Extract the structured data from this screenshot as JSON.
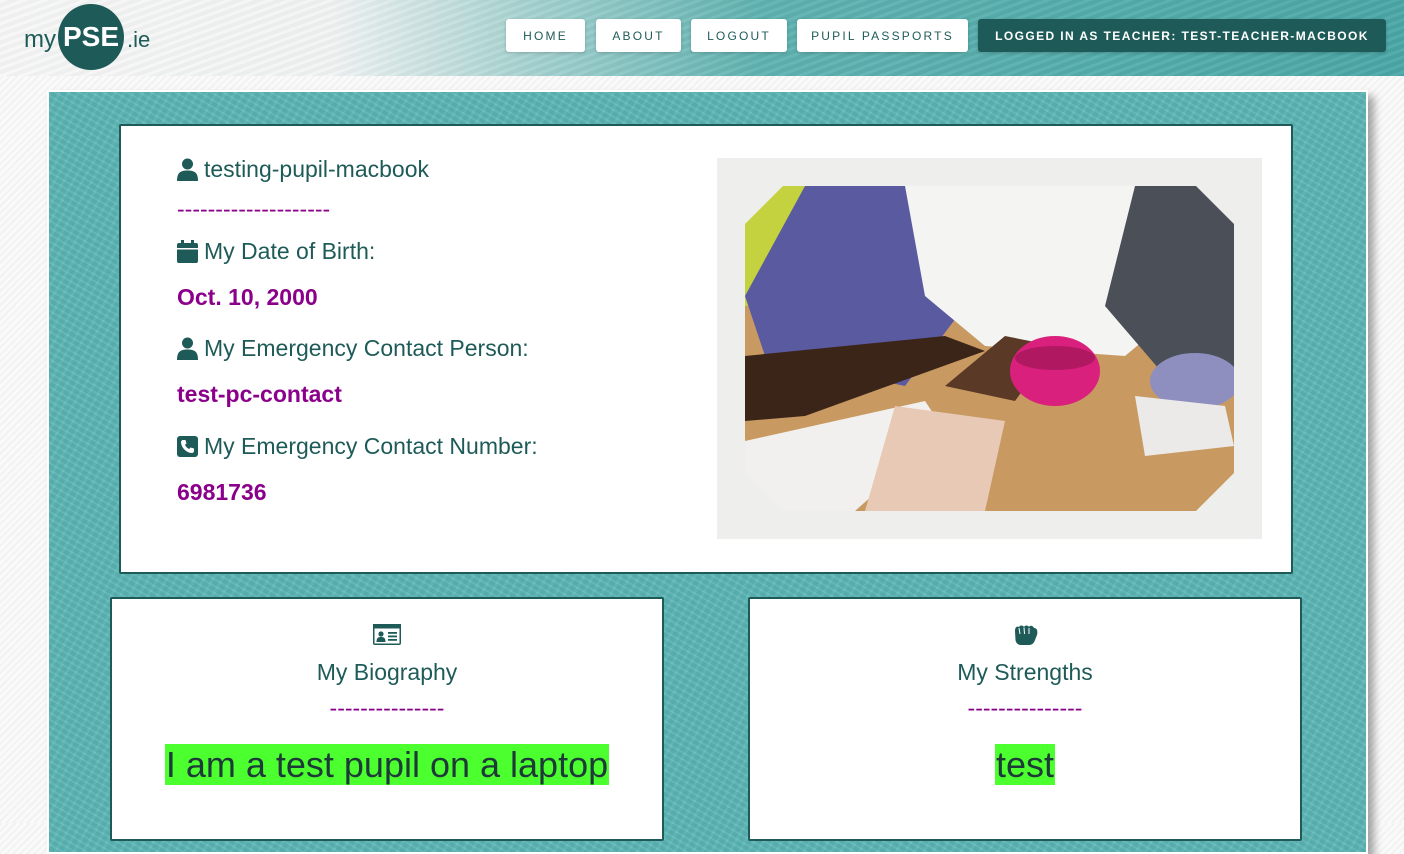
{
  "brand": {
    "prefix": "my",
    "core": "PSE",
    "suffix": ".ie"
  },
  "nav": {
    "home": "HOME",
    "about": "ABOUT",
    "logout": "LOGOUT",
    "passports": "PUPIL PASSPORTS",
    "user": "LOGGED IN AS TEACHER: TEST-TEACHER-MACBOOK"
  },
  "profile": {
    "name": "testing-pupil-macbook",
    "separator": "--------------------",
    "dob_label": "My Date of Birth:",
    "dob_value": "Oct. 10, 2000",
    "contact_person_label": "My Emergency Contact Person:",
    "contact_person_value": "test-pc-contact",
    "contact_number_label": "My Emergency Contact Number:",
    "contact_number_value": "6981736"
  },
  "biography": {
    "title": "My Biography",
    "separator": "---------------",
    "text": "I am a test pupil on a laptop"
  },
  "strengths": {
    "title": "My Strengths",
    "separator": "---------------",
    "text": "test"
  },
  "icons": {
    "name": "user-icon",
    "dob": "calendar-icon",
    "contact_person": "user-icon",
    "contact_number": "phone-icon",
    "biography": "id-card-icon",
    "strengths": "fist-icon"
  },
  "colors": {
    "primary": "#1e5b58",
    "accent": "#8b008b",
    "highlight": "#4cff2f",
    "panel": "#5ab5b4"
  }
}
